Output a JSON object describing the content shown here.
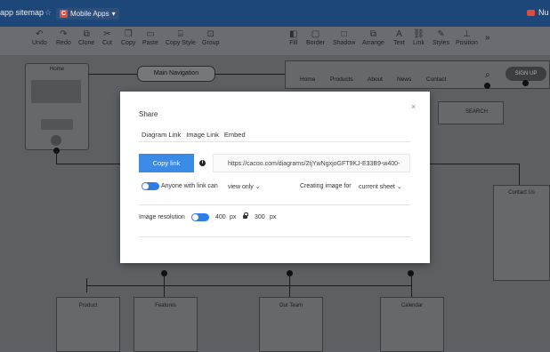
{
  "titlebar": {
    "doc_title": "app sitemap",
    "star": "☆",
    "folder_badge": "C",
    "folder": "Mobile Apps",
    "folder_caret": "▾",
    "user": "Nu"
  },
  "toolbar": {
    "items": [
      {
        "label": "Undo",
        "icon": "↶"
      },
      {
        "label": "Redo",
        "icon": "↷"
      },
      {
        "label": "Clone",
        "icon": "⧉"
      },
      {
        "label": "Cut",
        "icon": "✂"
      },
      {
        "label": "Copy",
        "icon": "❐"
      },
      {
        "label": "Paste",
        "icon": "▭"
      },
      {
        "label": "Copy Style",
        "icon": "⌸"
      },
      {
        "label": "Group",
        "icon": "⊡"
      },
      {
        "label": "Fill",
        "icon": "◧"
      },
      {
        "label": "Border",
        "icon": "▢"
      },
      {
        "label": "Shadow",
        "icon": "□"
      },
      {
        "label": "Arrange",
        "icon": "⧉"
      },
      {
        "label": "Text",
        "icon": "A"
      },
      {
        "label": "Link",
        "icon": "⛓"
      },
      {
        "label": "Styles",
        "icon": "✎"
      },
      {
        "label": "Position",
        "icon": "⊥"
      }
    ],
    "more": "»"
  },
  "diagram": {
    "home": "Home",
    "main_navigation": "Main Navigation",
    "nav_links": [
      "Home",
      "Products",
      "About",
      "News",
      "Contact"
    ],
    "sign_up": "SIGN UP",
    "search": "SEARCH",
    "contact_us": "Contact Us",
    "pages": [
      "Product",
      "Features",
      "Our Team",
      "Calendar"
    ]
  },
  "modal": {
    "title": "Share",
    "close": "×",
    "tabs": [
      "Diagram Link",
      "Image Link",
      "Embed"
    ],
    "active_tab": "Image Link",
    "copy_link": "Copy link",
    "info": "i",
    "url": "https://cacoo.com/diagrams/2tjYwNgxjoGFT9KJ-E33B9-w400-",
    "access_label": "Anyone with link can",
    "access_value": "view only",
    "access_caret": "⌄",
    "creating_label": "Creating image for",
    "sheet_value": "current sheet",
    "sheet_caret": "⌄",
    "resolution_label": "Image resolution",
    "width_value": "400",
    "height_value": "300",
    "unit_w": "px",
    "unit_h": "px"
  }
}
